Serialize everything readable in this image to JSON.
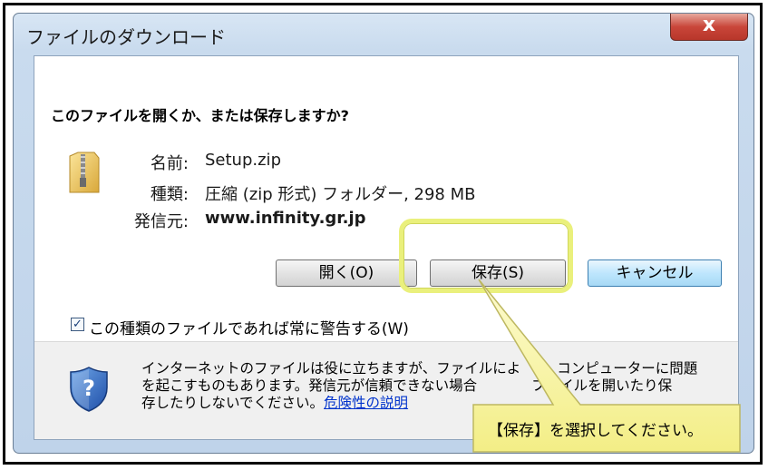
{
  "window": {
    "title": "ファイルのダウンロード",
    "close_icon_label": "x"
  },
  "dialog": {
    "question": "このファイルを開くか、または保存しますか?",
    "file_icon": "zip-folder-icon",
    "fields": {
      "name_label": "名前:",
      "name_value": "Setup.zip",
      "type_label": "種類:",
      "type_value": "圧縮 (zip 形式) フォルダー, 298 MB",
      "source_label": "発信元:",
      "source_value": "www.infinity.gr.jp"
    },
    "buttons": {
      "open": "開く(O)",
      "save": "保存(S)",
      "cancel": "キャンセル"
    },
    "checkbox": {
      "checked": true,
      "label": "この種類のファイルであれば常に警告する(W)"
    },
    "warning": {
      "icon": "security-shield-icon",
      "line1": "インターネットのファイルは役に立ちますが、ファイルによ",
      "line1_tail": "コンピューターに問題",
      "line2": "を起こすものもあります。発信元が信頼できない場合",
      "line2_tail": "ファイルを開いたり保",
      "line3": "存したりしないでください。",
      "link": "危険性の説明"
    }
  },
  "annotation": {
    "callout_text": "【保存】を選択してください。",
    "highlight_color": "#eaf07c",
    "callout_fill": "#fbf8a8"
  }
}
